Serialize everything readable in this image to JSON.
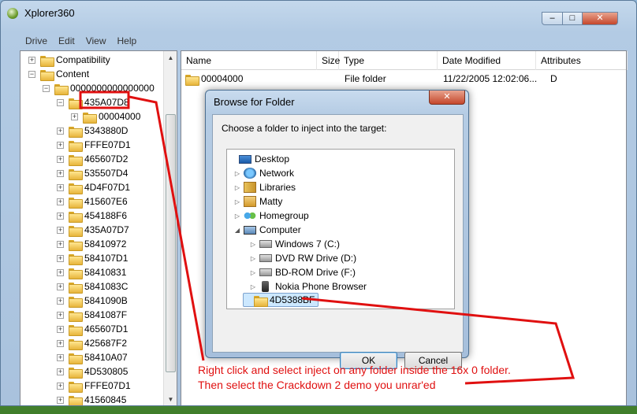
{
  "window": {
    "title": "Xplorer360",
    "min": "0",
    "max": "1",
    "close": "r"
  },
  "menu": [
    {
      "label": "Drive"
    },
    {
      "label": "Edit"
    },
    {
      "label": "View"
    },
    {
      "label": "Help"
    }
  ],
  "tree": {
    "items": [
      {
        "label": "Compatibility",
        "expander": "+"
      },
      {
        "label": "Content",
        "expander": "−"
      },
      {
        "label": "0000000000000000",
        "expander": "−"
      },
      {
        "label": "435A07D8",
        "expander": "−"
      },
      {
        "label": "00004000",
        "expander": "+"
      },
      {
        "label": "5343880D",
        "expander": "+"
      },
      {
        "label": "FFFE07D1",
        "expander": "+"
      },
      {
        "label": "465607D2",
        "expander": "+"
      },
      {
        "label": "535507D4",
        "expander": "+"
      },
      {
        "label": "4D4F07D1",
        "expander": "+"
      },
      {
        "label": "415607E6",
        "expander": "+"
      },
      {
        "label": "454188F6",
        "expander": "+"
      },
      {
        "label": "435A07D7",
        "expander": "+"
      },
      {
        "label": "58410972",
        "expander": "+"
      },
      {
        "label": "584107D1",
        "expander": "+"
      },
      {
        "label": "58410831",
        "expander": "+"
      },
      {
        "label": "5841083C",
        "expander": "+"
      },
      {
        "label": "5841090B",
        "expander": "+"
      },
      {
        "label": "5841087F",
        "expander": "+"
      },
      {
        "label": "465607D1",
        "expander": "+"
      },
      {
        "label": "425687F2",
        "expander": "+"
      },
      {
        "label": "58410A07",
        "expander": "+"
      },
      {
        "label": "4D530805",
        "expander": "+"
      },
      {
        "label": "FFFE07D1",
        "expander": "+"
      },
      {
        "label": "41560845",
        "expander": "+"
      }
    ]
  },
  "list": {
    "columns": [
      {
        "label": "Name"
      },
      {
        "label": "Size"
      },
      {
        "label": "Type"
      },
      {
        "label": "Date Modified"
      },
      {
        "label": "Attributes"
      }
    ],
    "rows": [
      {
        "name": "00004000",
        "size": "",
        "type": "File folder",
        "date": "11/22/2005 12:02:06...",
        "attributes": "D"
      }
    ]
  },
  "dialog": {
    "title": "Browse for Folder",
    "close": "x",
    "prompt": "Choose a folder to inject into the target:",
    "items": [
      {
        "label": "Desktop",
        "icon": "desktop-icon",
        "expander": ""
      },
      {
        "label": "Network",
        "icon": "network-icon",
        "expander": "▷"
      },
      {
        "label": "Libraries",
        "icon": "libraries-icon",
        "expander": "▷"
      },
      {
        "label": "Matty",
        "icon": "user-folder-icon",
        "expander": "▷"
      },
      {
        "label": "Homegroup",
        "icon": "homegroup-icon",
        "expander": "▷"
      },
      {
        "label": "Computer",
        "icon": "computer-icon",
        "expander": "◢"
      },
      {
        "label": "Windows 7 (C:)",
        "icon": "drive-icon",
        "expander": "▷"
      },
      {
        "label": "DVD RW Drive (D:)",
        "icon": "dvd-drive-icon",
        "expander": "▷"
      },
      {
        "label": "BD-ROM Drive (F:)",
        "icon": "bd-drive-icon",
        "expander": "▷"
      },
      {
        "label": "Nokia Phone Browser",
        "icon": "phone-icon",
        "expander": "▷"
      },
      {
        "label": "4D5388BF",
        "icon": "folder-icon",
        "expander": ""
      }
    ],
    "ok": "OK",
    "cancel": "Cancel"
  },
  "annotation": {
    "line1": "Right click and select inject on any folder inside the 16x 0 folder.",
    "line2": "Then select the Crackdown 2 demo you unrar'ed",
    "color": "#e01010"
  }
}
